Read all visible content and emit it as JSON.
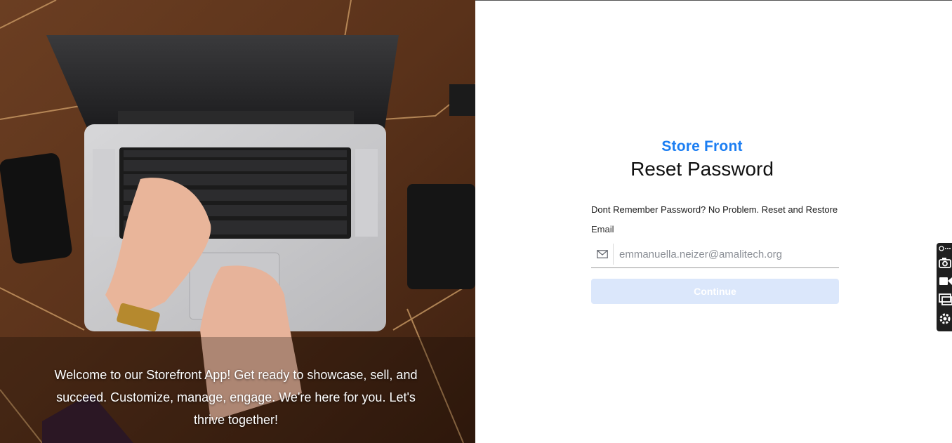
{
  "hero": {
    "caption": "Welcome to our Storefront App! Get ready to showcase, sell, and succeed. Customize, manage, engage. We're here for you. Let's thrive together!"
  },
  "form": {
    "brand": "Store Front",
    "title": "Reset Password",
    "subtitle": "Dont Remember Password? No Problem. Reset and Restore",
    "email_label": "Email",
    "email_placeholder": "emmanuella.neizer@amalitech.org",
    "email_value": "",
    "continue_label": "Continue"
  },
  "icons": {
    "email_field": "mail-icon",
    "dock": [
      "extension-icon",
      "camera-icon",
      "video-icon",
      "screen-icon",
      "settings-icon"
    ]
  },
  "colors": {
    "brand": "#1c7ef2",
    "button_disabled": "#dbe7fb",
    "title": "#111111"
  }
}
